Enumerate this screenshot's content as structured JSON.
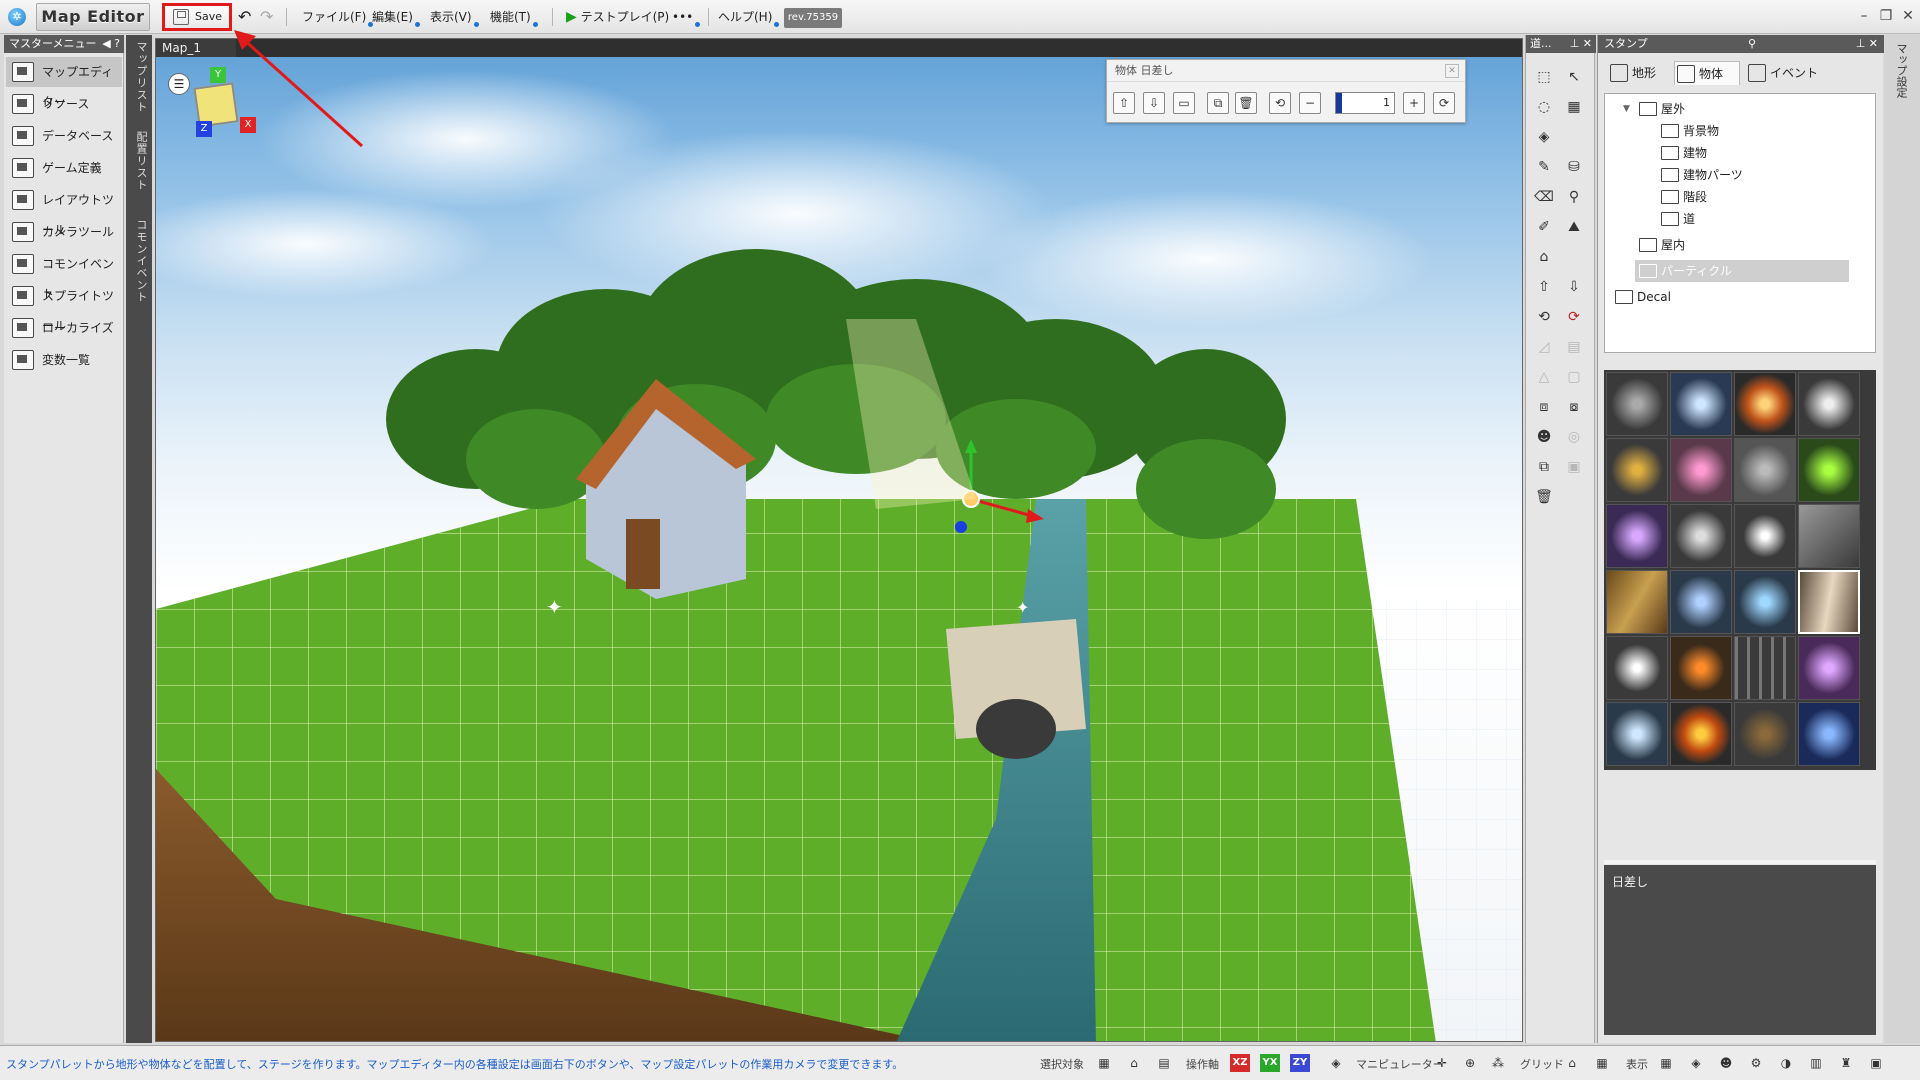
{
  "window": {
    "title": "Map Editor",
    "rev": "rev.75359"
  },
  "toolbar": {
    "save_label": "Save",
    "menus": [
      "ファイル(F)",
      "編集(E)",
      "表示(V)",
      "機能(T)"
    ],
    "testplay_label": "テストプレイ(P)",
    "more_label": "•••",
    "help_label": "ヘルプ(H)"
  },
  "leftpanel": {
    "title": "マスターメニュー",
    "items": [
      "マップエディター",
      "リソース",
      "データベース",
      "ゲーム定義",
      "レイアウトツール",
      "カメラツール",
      "コモンイベント",
      "スプライトツール",
      "ローカライズ",
      "変数一覧"
    ]
  },
  "vtabs": [
    "マップリスト",
    "配置リスト",
    "コモンイベント"
  ],
  "viewport": {
    "map_tab": "Map_1",
    "gizmo": {
      "y": "Y",
      "x": "X",
      "z": "Z"
    }
  },
  "float_toolbar": {
    "title": "物体 日差し",
    "value": "1"
  },
  "tools_panel": {
    "title": "道..."
  },
  "stamp_panel": {
    "title": "スタンプ",
    "tabs": [
      "地形",
      "物体",
      "イベント"
    ],
    "tree": [
      {
        "label": "屋外",
        "level": 0
      },
      {
        "label": "背景物",
        "level": 1
      },
      {
        "label": "建物",
        "level": 1
      },
      {
        "label": "建物パーツ",
        "level": 1
      },
      {
        "label": "階段",
        "level": 1
      },
      {
        "label": "道",
        "level": 1
      },
      {
        "label": "屋内",
        "level": 0
      },
      {
        "label": "パーティクル",
        "level": 0
      },
      {
        "label": "Decal",
        "level": -1
      }
    ],
    "selected_name": "日差し"
  },
  "right_vtab": "マップ設定",
  "statusbar": {
    "message": "スタンプパレットから地形や物体などを配置して、ステージを作ります。マップエディター内の各種設定は画面右下のボタンや、マップ設定パレットの作業用カメラで変更できます。",
    "select_target_label": "選択対象",
    "axis_label": "操作軸",
    "axes": [
      "XZ",
      "YX",
      "ZY"
    ],
    "manipulator_label": "マニピュレーター",
    "grid_label": "グリッド",
    "display_label": "表示"
  },
  "colors": {
    "highlight_red": "#e01a1a",
    "status_text_blue": "#1a5dcc",
    "panel_header": "#5a5a5a"
  }
}
